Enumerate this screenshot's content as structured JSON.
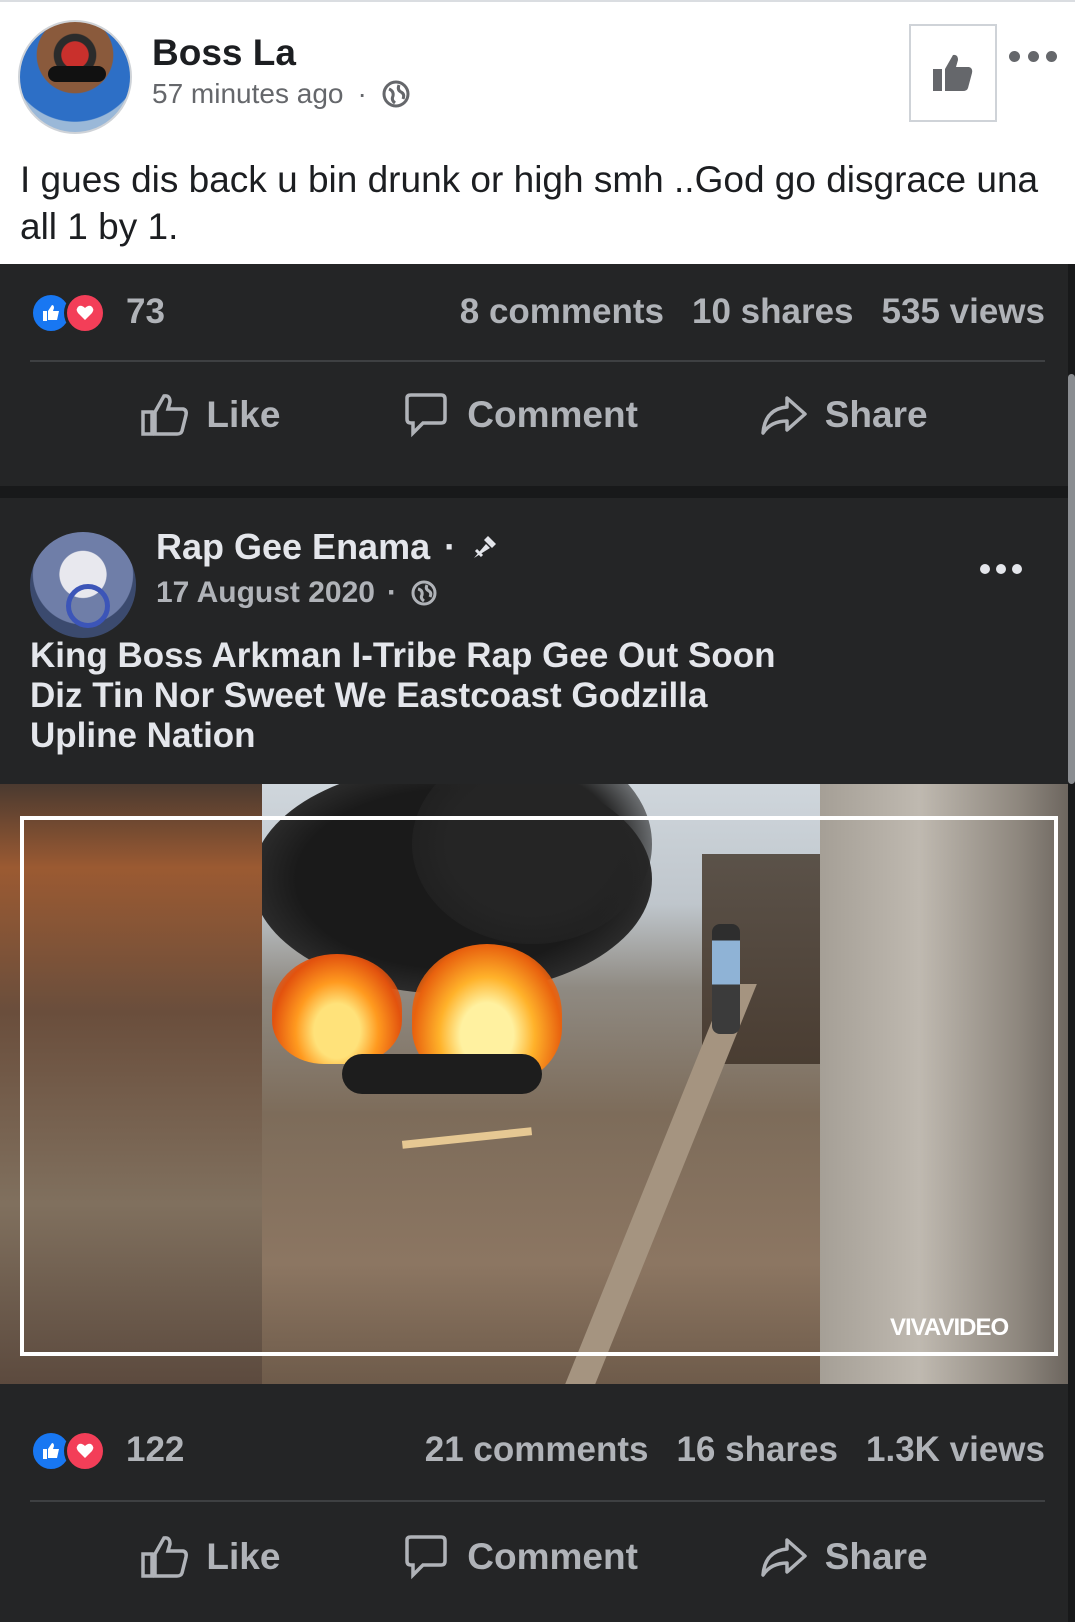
{
  "outer_post": {
    "author": "Boss La",
    "time": "57 minutes ago",
    "separator": "·",
    "text": "I gues dis back u bin drunk or high smh ..God go disgrace una all 1 by 1."
  },
  "shared_top": {
    "reaction_count": "73",
    "comments": "8 comments",
    "shares": "10 shares",
    "views": "535 views",
    "actions": {
      "like": "Like",
      "comment": "Comment",
      "share": "Share"
    }
  },
  "shared_post": {
    "author": "Rap Gee Enama",
    "name_separator": "·",
    "date": "17 August 2020",
    "date_separator": "·",
    "text": "King Boss Arkman I-Tribe Rap Gee Out Soon Diz Tin Nor Sweet We Eastcoast Godzilla Upline Nation",
    "watermark": "VIVAVIDEO",
    "reaction_count": "122",
    "comments": "21 comments",
    "shares": "16 shares",
    "views": "1.3K views",
    "actions": {
      "like": "Like",
      "comment": "Comment",
      "share": "Share"
    }
  },
  "colors": {
    "like_blue": "#1877f2",
    "love_red": "#f33e58",
    "dark_bg": "#242526"
  }
}
